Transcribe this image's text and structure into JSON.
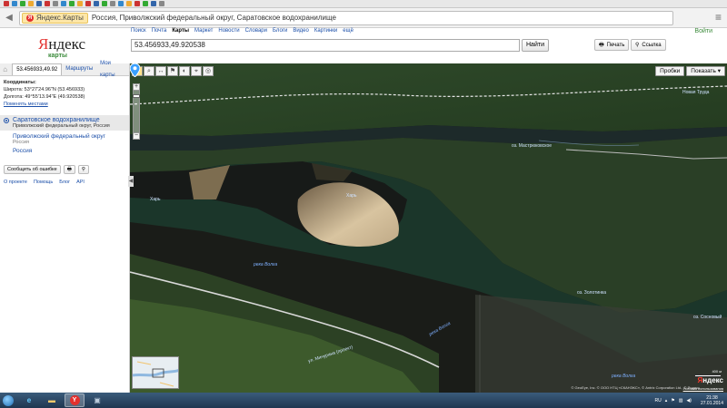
{
  "browser": {
    "tab_site": "Яндекс.Карты",
    "title": "Россия, Приволжский федеральный округ, Саратовское водохранилище"
  },
  "header": {
    "logo": "Яндекс",
    "logo_sub": "карты",
    "services": [
      "Поиск",
      "Почта",
      "Карты",
      "Маркет",
      "Новости",
      "Словари",
      "Блоги",
      "Видео",
      "Картинки",
      "ещё"
    ],
    "active_service": "Карты",
    "login": "Войти",
    "search_value": "53.456933,49.920538",
    "find_button": "Найти",
    "print_button": "Печать",
    "link_button": "Ссылка"
  },
  "sidebar": {
    "tab_search": "53.456933,49.92",
    "tab_routes": "Маршруты",
    "tab_mymaps": "Мои карты",
    "coords_title": "Координаты:",
    "latitude": "Широта: 53°27'24.96\"N (53.456933)",
    "longitude": "Долгота: 49°55'13.94\"E (49.920538)",
    "swap_link": "Поменять местами",
    "result_title": "Саратовское водохранилище",
    "result_sub": "Приволжский федеральный округ, Россия",
    "item1_title": "Приволжский федеральный округ",
    "item1_sub": "Россия",
    "item2_title": "Россия",
    "report_button": "Сообщить об ошибке",
    "footer_links": [
      "О проекте",
      "Помощь",
      "Блог",
      "API"
    ]
  },
  "map": {
    "layers_button": "Пробки",
    "show_button": "Показать",
    "labels": {
      "river1": "река Волга",
      "river2": "река Волга",
      "river3": "река Волга",
      "village": "Новая Труда",
      "mastryukovo": "оз. Мастрюковское",
      "zolotinka": "оз. Золотинка",
      "sosnovy": "оз. Сосновый",
      "island1": "Харь",
      "island2": "Харь",
      "road": "ул. Мичурина (проект)"
    },
    "scale_label": "400 м",
    "copyright": "© GeoEye, Inc. © ООО НТЦ «СКАНЭКС», © Antrix Corporation Ltd., © Яндекс",
    "brand": "Яндекс",
    "terms": "Условия использования"
  },
  "taskbar": {
    "lang": "RU",
    "time": "21:38",
    "date": "27.01.2014"
  },
  "colors": {
    "accent_red": "#e3312e",
    "link_blue": "#1a4ea8",
    "brand_green": "#3a8a3a"
  }
}
